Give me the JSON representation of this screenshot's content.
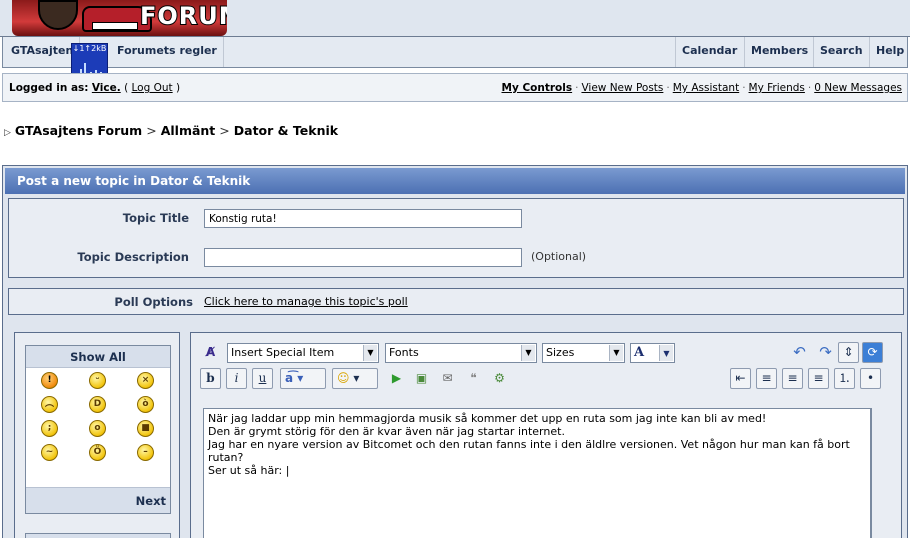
{
  "banner": {
    "logo_text": "FORUM"
  },
  "nav": {
    "left": [
      "GTAsajten",
      "Forumets regler"
    ],
    "right": [
      "Calendar",
      "Members",
      "Search",
      "Help"
    ]
  },
  "netmon": {
    "text": "↓1↑2kB"
  },
  "userbar": {
    "logged_in_label": "Logged in as:",
    "username": "Vice.",
    "logout": "Log Out",
    "links": [
      "My Controls",
      "View New Posts",
      "My Assistant",
      "My Friends",
      "0 New Messages"
    ]
  },
  "breadcrumb": [
    "GTAsajtens Forum",
    "Allmänt",
    "Dator & Teknik"
  ],
  "form": {
    "header": "Post a new topic in Dator & Teknik",
    "title_label": "Topic Title",
    "title_value": "Konstig ruta!",
    "desc_label": "Topic Description",
    "desc_value": "",
    "optional": "(Optional)",
    "poll_label": "Poll Options",
    "poll_link": "Click here to manage this topic's poll"
  },
  "emoticons": {
    "show_all": "Show All",
    "next": "Next",
    "icons": [
      "warning-icon",
      "smile-icon",
      "annoyed-icon",
      "sad-icon",
      "biggrin-icon",
      "mad-icon",
      "wink-icon",
      "ohmy-icon",
      "cool-icon",
      "sleepy-icon",
      "laugh-icon",
      "blank-icon"
    ]
  },
  "toolbar": {
    "special": "Insert Special Item",
    "fonts": "Fonts",
    "sizes": "Sizes",
    "color_glyph": "A"
  },
  "post": {
    "body": "När jag laddar upp min hemmagjorda musik så kommer det upp en ruta som jag inte kan bli av med!\nDen är grymt störig för den är kvar även när jag startar internet.\nJag har en nyare version av Bitcomet och den rutan fanns inte i den äldlre versionen. Vet någon hur man kan få bort rutan?\nSer ut så här: |"
  }
}
